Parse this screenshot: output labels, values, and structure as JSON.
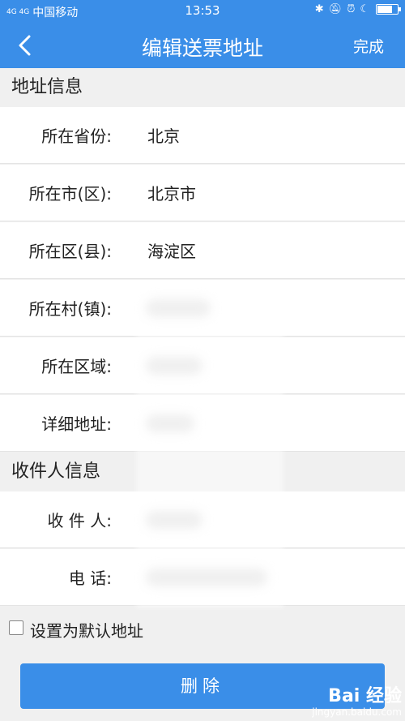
{
  "status_bar": {
    "signal": "4G 4G",
    "carrier": "中国移动",
    "time": "13:53",
    "battery_level": 0.8
  },
  "navbar": {
    "title": "编辑送票地址",
    "done_label": "完成"
  },
  "address_section": {
    "title": "地址信息",
    "rows": [
      {
        "label": "所在省份:",
        "value": "北京"
      },
      {
        "label": "所在市(区):",
        "value": "北京市"
      },
      {
        "label": "所在区(县):",
        "value": "海淀区"
      },
      {
        "label": "所在村(镇):",
        "value": ""
      },
      {
        "label": "所在区域:",
        "value": ""
      },
      {
        "label": "详细地址:",
        "value": ""
      }
    ]
  },
  "recipient_section": {
    "title": "收件人信息",
    "rows": [
      {
        "label": "收 件 人:",
        "value": ""
      },
      {
        "label": "电    话:",
        "value": ""
      }
    ]
  },
  "default_address": {
    "label": "设置为默认地址",
    "checked": false
  },
  "delete_button": {
    "label": "删除"
  },
  "watermark": {
    "brand": "Bai 经验",
    "url": "jingyan.baidu.com"
  },
  "colors": {
    "primary": "#3a8ee8",
    "background": "#f0f0f0"
  }
}
